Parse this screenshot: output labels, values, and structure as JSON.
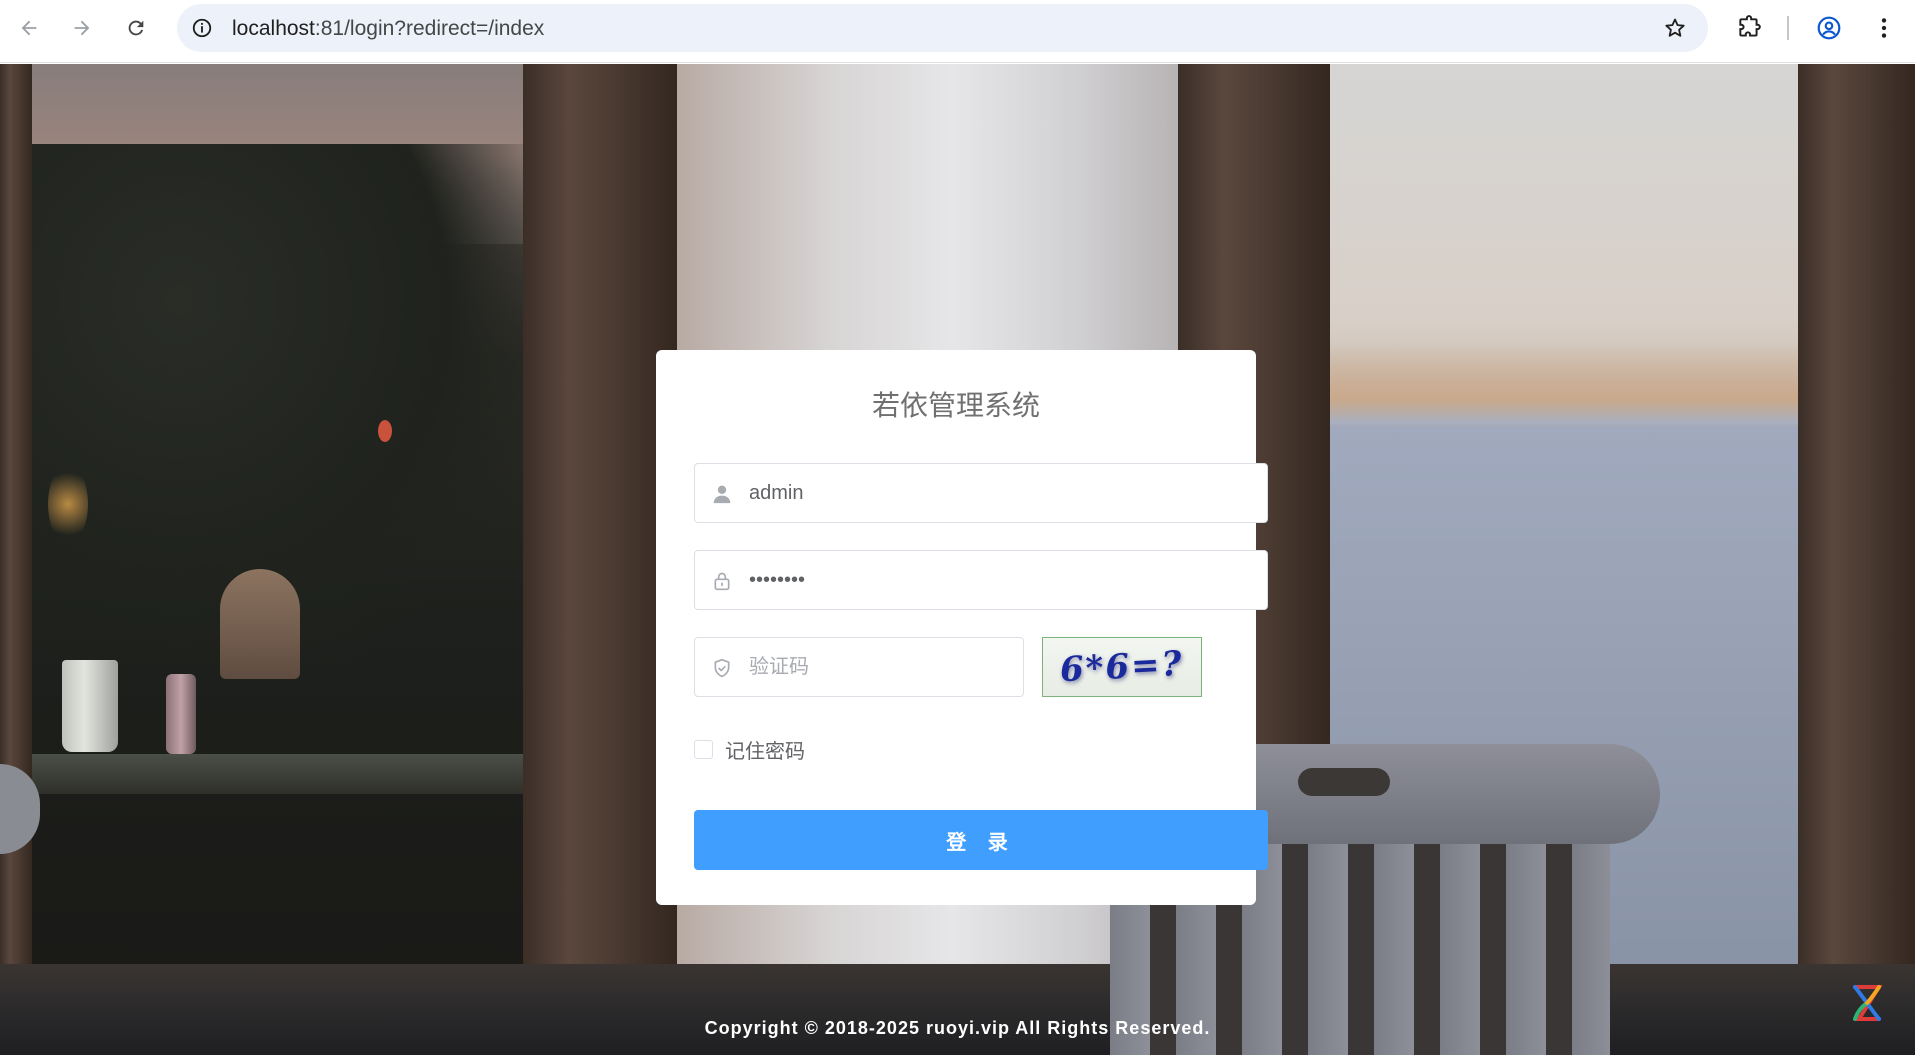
{
  "browser": {
    "url_host": "localhost",
    "url_rest": ":81/login?redirect=/index"
  },
  "login": {
    "title": "若依管理系统",
    "username_value": "admin",
    "password_value": "********",
    "captcha_placeholder": "验证码",
    "captcha_text": "6*6=?",
    "remember_label": "记住密码",
    "remember_checked": false,
    "login_button": "登 录"
  },
  "footer": {
    "copyright": "Copyright © 2018-2025 ruoyi.vip All Rights Reserved."
  },
  "colors": {
    "primary": "#409eff",
    "card_bg": "#ffffff",
    "title_text": "#707070"
  },
  "icons": {
    "back": "arrow-left-icon",
    "forward": "arrow-right-icon",
    "reload": "reload-icon",
    "site_info": "info-icon",
    "bookmark": "star-icon",
    "extensions": "puzzle-icon",
    "profile": "user-circle-icon",
    "menu": "more-vertical-icon",
    "username": "user-icon",
    "password": "lock-icon",
    "captcha": "shield-icon",
    "widget": "assistant-icon"
  }
}
